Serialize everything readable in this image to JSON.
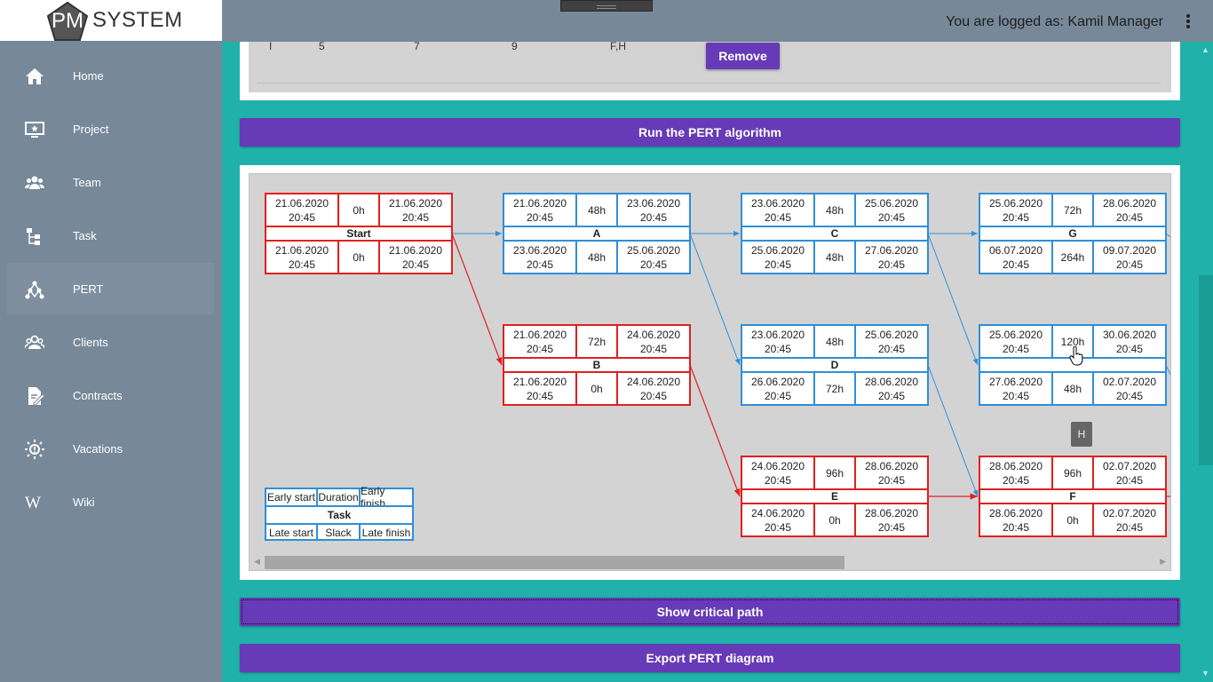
{
  "brand": {
    "pm": "PM",
    "system": "SYSTEM"
  },
  "header": {
    "user_text": "You are logged as: Kamil Manager"
  },
  "sidebar": {
    "items": [
      {
        "label": "Home",
        "icon": "home-icon"
      },
      {
        "label": "Project",
        "icon": "project-icon"
      },
      {
        "label": "Team",
        "icon": "team-icon"
      },
      {
        "label": "Task",
        "icon": "task-icon"
      },
      {
        "label": "PERT",
        "icon": "pert-icon",
        "active": true
      },
      {
        "label": "Clients",
        "icon": "clients-icon"
      },
      {
        "label": "Contracts",
        "icon": "contracts-icon"
      },
      {
        "label": "Vacations",
        "icon": "vacations-icon"
      },
      {
        "label": "Wiki",
        "icon": "wiki-icon"
      }
    ]
  },
  "task_row": {
    "name": "I",
    "optimistic": "5",
    "most_likely": "7",
    "pessimistic": "9",
    "predecessors": "F,H"
  },
  "buttons": {
    "remove": "Remove",
    "run_pert": "Run the PERT algorithm",
    "critical_path": "Show critical path",
    "export": "Export PERT diagram"
  },
  "pert": {
    "nodes": [
      {
        "id": "start",
        "name": "Start",
        "critical": true,
        "es": "21.06.2020\n20:45",
        "dur": "0h",
        "ef": "21.06.2020\n20:45",
        "ls": "21.06.2020\n20:45",
        "slack": "0h",
        "lf": "21.06.2020\n20:45"
      },
      {
        "id": "a",
        "name": "A",
        "critical": false,
        "es": "21.06.2020\n20:45",
        "dur": "48h",
        "ef": "23.06.2020\n20:45",
        "ls": "23.06.2020\n20:45",
        "slack": "48h",
        "lf": "25.06.2020\n20:45"
      },
      {
        "id": "c",
        "name": "C",
        "critical": false,
        "es": "23.06.2020\n20:45",
        "dur": "48h",
        "ef": "25.06.2020\n20:45",
        "ls": "25.06.2020\n20:45",
        "slack": "48h",
        "lf": "27.06.2020\n20:45"
      },
      {
        "id": "g",
        "name": "G",
        "critical": false,
        "es": "25.06.2020\n20:45",
        "dur": "72h",
        "ef": "28.06.2020\n20:45",
        "ls": "06.07.2020\n20:45",
        "slack": "264h",
        "lf": "09.07.2020\n20:45"
      },
      {
        "id": "b",
        "name": "B",
        "critical": true,
        "es": "21.06.2020\n20:45",
        "dur": "72h",
        "ef": "24.06.2020\n20:45",
        "ls": "21.06.2020\n20:45",
        "slack": "0h",
        "lf": "24.06.2020\n20:45"
      },
      {
        "id": "d",
        "name": "D",
        "critical": false,
        "es": "23.06.2020\n20:45",
        "dur": "48h",
        "ef": "25.06.2020\n20:45",
        "ls": "26.06.2020\n20:45",
        "slack": "72h",
        "lf": "28.06.2020\n20:45"
      },
      {
        "id": "h",
        "name": "",
        "critical": false,
        "es": "25.06.2020\n20:45",
        "dur": "120h",
        "ef": "30.06.2020\n20:45",
        "ls": "27.06.2020\n20:45",
        "slack": "48h",
        "lf": "02.07.2020\n20:45"
      },
      {
        "id": "e",
        "name": "E",
        "critical": true,
        "es": "24.06.2020\n20:45",
        "dur": "96h",
        "ef": "28.06.2020\n20:45",
        "ls": "24.06.2020\n20:45",
        "slack": "0h",
        "lf": "28.06.2020\n20:45"
      },
      {
        "id": "f",
        "name": "F",
        "critical": true,
        "es": "28.06.2020\n20:45",
        "dur": "96h",
        "ef": "02.07.2020\n20:45",
        "ls": "28.06.2020\n20:45",
        "slack": "0h",
        "lf": "02.07.2020\n20:45"
      }
    ],
    "legend": {
      "es": "Early start",
      "dur": "Duration",
      "ef": "Early finish",
      "task": "Task",
      "ls": "Late start",
      "slack": "Slack",
      "lf": "Late finish"
    },
    "tooltip": "H",
    "colors": {
      "critical": "#e02020",
      "normal": "#2f8fd8"
    }
  }
}
